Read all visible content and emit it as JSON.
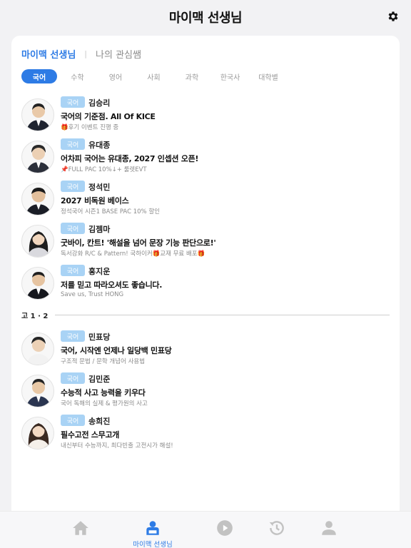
{
  "header": {
    "title": "마이맥 선생님"
  },
  "segments": {
    "active": "마이맥 선생님",
    "inactive": "나의 관심쌤"
  },
  "subjects": [
    "국어",
    "수학",
    "영어",
    "사회",
    "과학",
    "한국사",
    "대학별"
  ],
  "teachers": [
    {
      "tag": "국어",
      "name": "김승리",
      "slogan": "국어의 기준점. All Of KICE",
      "sub": "🎁후기 이벤트 진행 중"
    },
    {
      "tag": "국어",
      "name": "유대종",
      "slogan": "어차피 국어는 유대종, 2027 인셉션 오픈!",
      "sub": "📌FULL PAC 10%↓+ 룰렛EVT"
    },
    {
      "tag": "국어",
      "name": "정석민",
      "slogan": "2027 비독원 베이스",
      "sub": "정석국어 시즌1 BASE PAC 10% 할인"
    },
    {
      "tag": "국어",
      "name": "김젬마",
      "slogan": "굿바이, 칸트! '해설을 넘어 문장 기능 판단으로!'",
      "sub": "독서강화 R/C & Pattern! 국하이커🎁교재 무료 배포🎁"
    },
    {
      "tag": "국어",
      "name": "홍지운",
      "slogan": "저를 믿고 따라오셔도 좋습니다.",
      "sub": "Save us, Trust HONG"
    }
  ],
  "section_label": "고 1 · 2",
  "teachers2": [
    {
      "tag": "국어",
      "name": "민표당",
      "slogan": "국어, 시작엔 언제나 일당백 민표당",
      "sub": "구조적 문법 / 문학 개념어 사용법"
    },
    {
      "tag": "국어",
      "name": "김민준",
      "slogan": "수능적 사고 능력을 키우다",
      "sub": "국어 독해의 실제 & 평가원의 사고"
    },
    {
      "tag": "국어",
      "name": "송희진",
      "slogan": "필수고전 스무고개",
      "sub": "내신부터 수능까지, 최다빈출 고전시가 해설!"
    }
  ],
  "tabbar": {
    "active_label": "마이맥 선생님"
  },
  "colors": {
    "accent": "#2d7be5",
    "tag_bg": "#a9d3f5",
    "icon_gray": "#c2c2c2"
  }
}
